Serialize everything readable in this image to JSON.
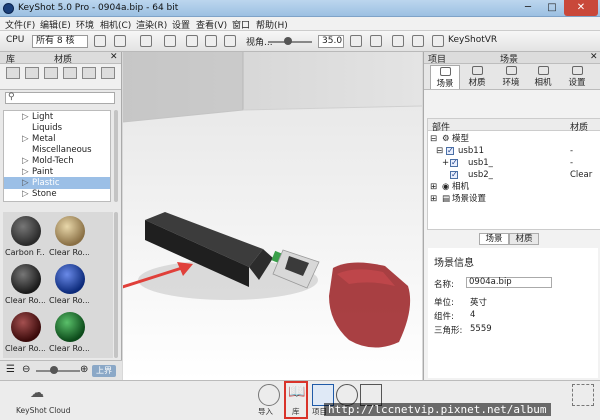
{
  "window": {
    "title": "KeyShot 5.0 Pro  -  0904a.bip  -  64 bit",
    "minimize": "─",
    "maximize": "□",
    "close": "✕"
  },
  "menu": [
    "文件(F)",
    "编辑(E)",
    "环境",
    "相机(C)",
    "渲染(R)",
    "设置",
    "查看(V)",
    "窗口",
    "帮助(H)"
  ],
  "toolbar": {
    "cpu_label": "CPU",
    "cpu_value": "所有 8 核",
    "view_label": "视角...",
    "fov_value": "35.0",
    "keyshotvr": "KeyShotVR"
  },
  "left_panel": {
    "header_left": "库",
    "header_right": "材质",
    "search_placeholder": "",
    "tree": [
      "Light",
      "Liquids",
      "Metal",
      "Miscellaneous",
      "Mold-Tech",
      "Paint",
      "Plastic",
      "Stone"
    ],
    "selected_tree_item": "Plastic",
    "thumbs": [
      {
        "label": "Carbon F...",
        "color": "#2a2a2a"
      },
      {
        "label": "Clear Ro...",
        "color": "#b69a6a"
      },
      {
        "label": "Clear Ro...",
        "color": "#2d2d2d"
      },
      {
        "label": "Clear Ro...",
        "color": "#1d3f9a"
      },
      {
        "label": "Clear Ro...",
        "color": "#5a1a1a"
      },
      {
        "label": "Clear Ro...",
        "color": "#1e6a2a"
      }
    ],
    "up_button": "上界"
  },
  "right_panel": {
    "header_left": "项目",
    "header_right": "场景",
    "tabs": [
      "场景",
      "材质",
      "环境",
      "相机",
      "设置"
    ],
    "tree_header_left": "部件",
    "tree_header_right": "材质",
    "tree_rows": [
      {
        "label": "模型",
        "material": ""
      },
      {
        "label": "usb11",
        "material": "-"
      },
      {
        "label": "usb1_",
        "material": "-"
      },
      {
        "label": "usb2_",
        "material": "Clear"
      },
      {
        "label": "相机",
        "material": ""
      },
      {
        "label": "场景设置",
        "material": ""
      }
    ],
    "subtabs": [
      "场景",
      "材质"
    ],
    "info": {
      "title": "场景信息",
      "name_label": "名称:",
      "name_value": "0904a.bip",
      "unit_label": "单位:",
      "unit_value": "英寸",
      "parts_label": "组件:",
      "parts_value": "4",
      "tri_label": "三角形:",
      "tri_value": "5559"
    }
  },
  "bottom": {
    "cloud": "KeyShot Cloud",
    "import": "导入",
    "library": "库",
    "project": "项目"
  },
  "watermark": "http://lccnetvip.pixnet.net/album",
  "colors": {
    "accent": "#9bbfe6",
    "highlight_box": "#d9332a",
    "arrow": "#e0403a"
  }
}
